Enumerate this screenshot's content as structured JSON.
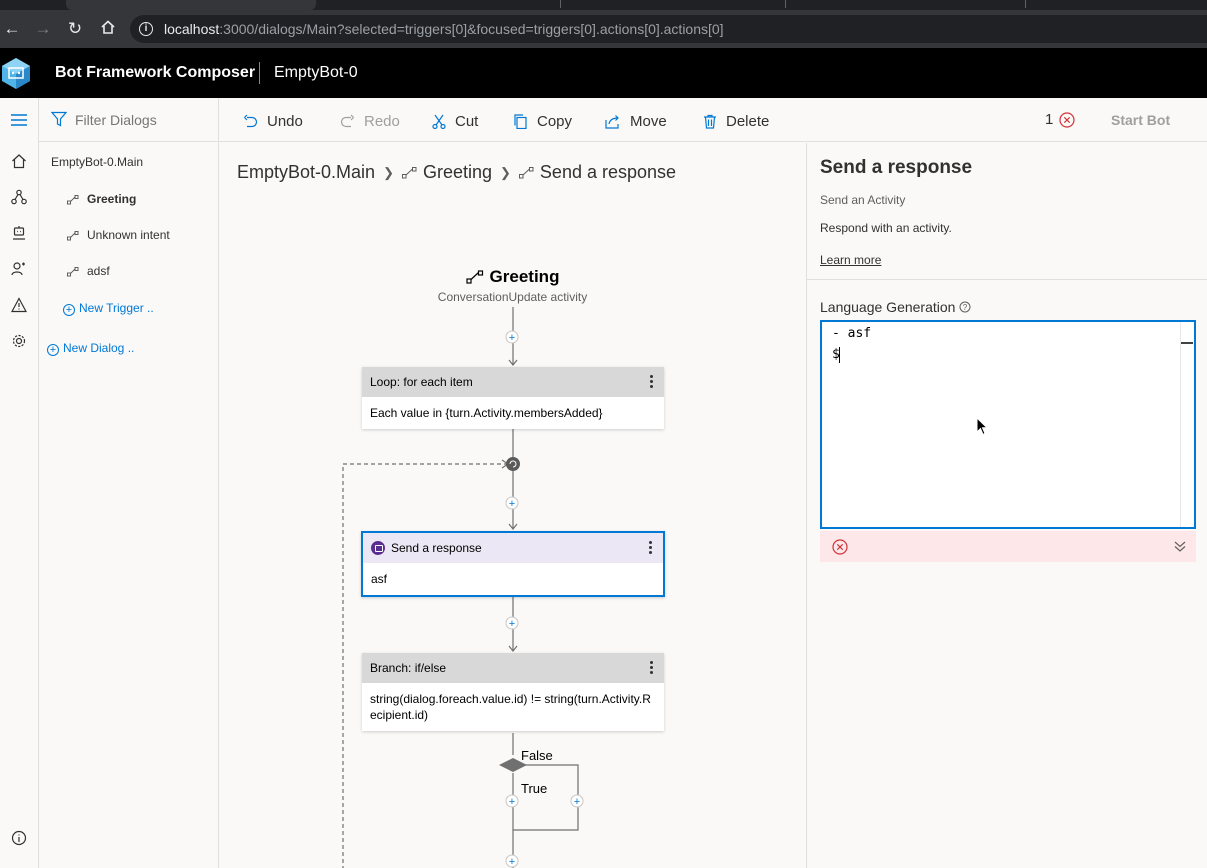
{
  "browser": {
    "url_host": "localhost",
    "url_path": ":3000/dialogs/Main?selected=triggers[0]&focused=triggers[0].actions[0].actions[0]"
  },
  "header": {
    "app_title": "Bot Framework Composer",
    "bot_name": "EmptyBot-0"
  },
  "nav_icons": [
    "home-icon",
    "flow-icon",
    "bot-responses-icon",
    "user-input-icon",
    "warning-icon",
    "settings-icon",
    "info-icon"
  ],
  "dialog_tree": {
    "filter_placeholder": "Filter Dialogs",
    "dialog_name": "EmptyBot-0.Main",
    "triggers": [
      "Greeting",
      "Unknown intent",
      "adsf"
    ],
    "new_trigger": "New Trigger ..",
    "new_dialog": "New Dialog .."
  },
  "toolbar": {
    "undo": "Undo",
    "redo": "Redo",
    "cut": "Cut",
    "copy": "Copy",
    "move": "Move",
    "delete": "Delete",
    "error_count": "1",
    "start_bot": "Start Bot"
  },
  "canvas": {
    "breadcrumb": [
      "EmptyBot-0.Main",
      "Greeting",
      "Send a response"
    ],
    "trigger_name": "Greeting",
    "trigger_sub": "ConversationUpdate activity",
    "nodes": [
      {
        "header": "Loop: for each item",
        "body": "Each value in {turn.Activity.membersAdded}"
      },
      {
        "header": "Send a response",
        "body": "asf"
      },
      {
        "header": "Branch: if/else",
        "body": "string(dialog.foreach.value.id) != string(turn.Activity.Recipient.id)"
      }
    ],
    "branch_false": "False",
    "branch_true": "True"
  },
  "properties": {
    "title": "Send a response",
    "subtitle": "Send an Activity",
    "description": "Respond with an activity.",
    "learn_more": "Learn more",
    "lg_label": "Language Generation",
    "editor_lines": [
      "- asf",
      "$"
    ]
  },
  "colors": {
    "accent": "#0078d4",
    "header_bg": "#000000",
    "error_bg": "#fde7e9",
    "error": "#d13438",
    "send_response_badge": "#5c2d91"
  }
}
